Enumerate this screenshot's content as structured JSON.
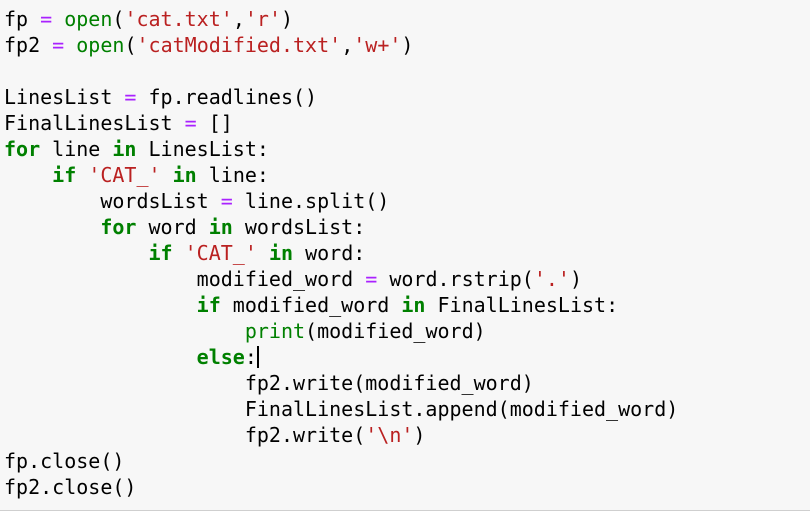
{
  "code_lines": [
    [
      {
        "t": "fp ",
        "c": "plain"
      },
      {
        "t": "=",
        "c": "op"
      },
      {
        "t": " ",
        "c": "plain"
      },
      {
        "t": "open",
        "c": "builtin"
      },
      {
        "t": "(",
        "c": "plain"
      },
      {
        "t": "'cat.txt'",
        "c": "str"
      },
      {
        "t": ",",
        "c": "plain"
      },
      {
        "t": "'r'",
        "c": "str"
      },
      {
        "t": ")",
        "c": "plain"
      }
    ],
    [
      {
        "t": "fp2 ",
        "c": "plain"
      },
      {
        "t": "=",
        "c": "op"
      },
      {
        "t": " ",
        "c": "plain"
      },
      {
        "t": "open",
        "c": "builtin"
      },
      {
        "t": "(",
        "c": "plain"
      },
      {
        "t": "'catModified.txt'",
        "c": "str"
      },
      {
        "t": ",",
        "c": "plain"
      },
      {
        "t": "'w+'",
        "c": "str"
      },
      {
        "t": ")",
        "c": "plain"
      }
    ],
    [],
    [
      {
        "t": "LinesList ",
        "c": "plain"
      },
      {
        "t": "=",
        "c": "op"
      },
      {
        "t": " fp.readlines()",
        "c": "plain"
      }
    ],
    [
      {
        "t": "FinalLinesList ",
        "c": "plain"
      },
      {
        "t": "=",
        "c": "op"
      },
      {
        "t": " []",
        "c": "plain"
      }
    ],
    [
      {
        "t": "for",
        "c": "kw"
      },
      {
        "t": " line ",
        "c": "plain"
      },
      {
        "t": "in",
        "c": "kw"
      },
      {
        "t": " LinesList:",
        "c": "plain"
      }
    ],
    [
      {
        "t": "    ",
        "c": "plain"
      },
      {
        "t": "if",
        "c": "kw"
      },
      {
        "t": " ",
        "c": "plain"
      },
      {
        "t": "'CAT_'",
        "c": "str"
      },
      {
        "t": " ",
        "c": "plain"
      },
      {
        "t": "in",
        "c": "kw"
      },
      {
        "t": " line:",
        "c": "plain"
      }
    ],
    [
      {
        "t": "        wordsList ",
        "c": "plain"
      },
      {
        "t": "=",
        "c": "op"
      },
      {
        "t": " line.split()",
        "c": "plain"
      }
    ],
    [
      {
        "t": "        ",
        "c": "plain"
      },
      {
        "t": "for",
        "c": "kw"
      },
      {
        "t": " word ",
        "c": "plain"
      },
      {
        "t": "in",
        "c": "kw"
      },
      {
        "t": " wordsList:",
        "c": "plain"
      }
    ],
    [
      {
        "t": "            ",
        "c": "plain"
      },
      {
        "t": "if",
        "c": "kw"
      },
      {
        "t": " ",
        "c": "plain"
      },
      {
        "t": "'CAT_'",
        "c": "str"
      },
      {
        "t": " ",
        "c": "plain"
      },
      {
        "t": "in",
        "c": "kw"
      },
      {
        "t": " word:",
        "c": "plain"
      }
    ],
    [
      {
        "t": "                modified_word ",
        "c": "plain"
      },
      {
        "t": "=",
        "c": "op"
      },
      {
        "t": " word.rstrip(",
        "c": "plain"
      },
      {
        "t": "'.'",
        "c": "str"
      },
      {
        "t": ")",
        "c": "plain"
      }
    ],
    [
      {
        "t": "                ",
        "c": "plain"
      },
      {
        "t": "if",
        "c": "kw"
      },
      {
        "t": " modified_word ",
        "c": "plain"
      },
      {
        "t": "in",
        "c": "kw"
      },
      {
        "t": " FinalLinesList:",
        "c": "plain"
      }
    ],
    [
      {
        "t": "                    ",
        "c": "plain"
      },
      {
        "t": "print",
        "c": "builtin"
      },
      {
        "t": "(modified_word)",
        "c": "plain"
      }
    ],
    [
      {
        "t": "                ",
        "c": "plain"
      },
      {
        "t": "else",
        "c": "kw"
      },
      {
        "t": ":",
        "c": "plain"
      },
      {
        "t": "",
        "c": "cursor"
      }
    ],
    [
      {
        "t": "                    fp2.write(modified_word)",
        "c": "plain"
      }
    ],
    [
      {
        "t": "                    FinalLinesList.append(modified_word)",
        "c": "plain"
      }
    ],
    [
      {
        "t": "                    fp2.write(",
        "c": "plain"
      },
      {
        "t": "'\\n'",
        "c": "str"
      },
      {
        "t": ")",
        "c": "plain"
      }
    ],
    [
      {
        "t": "fp.close()",
        "c": "plain"
      }
    ],
    [
      {
        "t": "fp2.close()",
        "c": "plain"
      }
    ]
  ],
  "colors": {
    "keyword": "#008000",
    "string": "#ba2121",
    "operator": "#aa22ff",
    "builtin": "#008000",
    "text": "#000000",
    "background": "#f7f7f7"
  }
}
